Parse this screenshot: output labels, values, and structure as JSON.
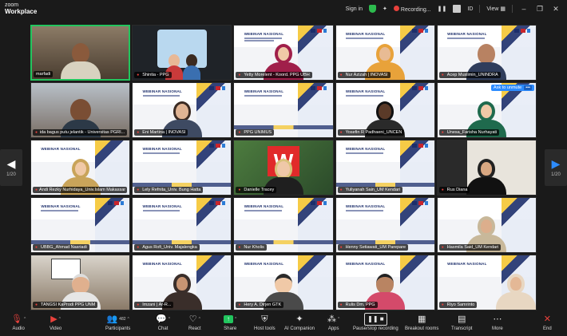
{
  "app": {
    "brand_line1": "zoom",
    "brand_line2": "Workplace"
  },
  "titlebar": {
    "sign_in": "Sign in",
    "recording": "Recording...",
    "id_label": "ID",
    "view": "View"
  },
  "nav": {
    "left_page": "1/20",
    "right_page": "1/20"
  },
  "tiles": [
    {
      "name": "marfadi",
      "active": true
    },
    {
      "name": "Shintia - PPG"
    },
    {
      "name": "Yetty Morelent - Koord. PPG UBH"
    },
    {
      "name": "Nur Azizah | INOVASI"
    },
    {
      "name": "Acep Muslimin_UNINDRA"
    },
    {
      "name": "ida bagus putu jelantik - Universitas PGRI..."
    },
    {
      "name": "Eni Martina | INOVASI"
    },
    {
      "name": "PPG UNIMUS"
    },
    {
      "name": "Yosefin R Padhaeni_UNCEN"
    },
    {
      "name": "Unesa_Farisha Nurhayati",
      "ask_unmute": "Ask to unmute"
    },
    {
      "name": "Andi Rezky Nurhidaya_Univ.Islam Makassar"
    },
    {
      "name": "Lely Refnita_Univ. Bung Hatta"
    },
    {
      "name": "Danielle Tracey"
    },
    {
      "name": "Yuliyanah Sain_UM Kendari"
    },
    {
      "name": "Rus Diana"
    },
    {
      "name": "UBBG_Ahmad Nasriadi"
    },
    {
      "name": "Agus Rofi_Univ. Majalengka"
    },
    {
      "name": "Nur Kholis"
    },
    {
      "name": "Henny Setiawati_UM Parepare"
    },
    {
      "name": "Hasmila Said_UM Kendari"
    },
    {
      "name": "TANGSI KaProdi PPG UNM"
    },
    {
      "name": "Imzani | Ar-R..."
    },
    {
      "name": "Hery A. Dirjen GTK"
    },
    {
      "name": "Rulis Dm. PPG"
    },
    {
      "name": "Riyo Samrinto"
    }
  ],
  "slide": {
    "title": "WEBINAR NASIONAL"
  },
  "toolbar": {
    "audio": "Audio",
    "video": "Video",
    "participants": "Participants",
    "participants_count": "482",
    "chat": "Chat",
    "react": "React",
    "share": "Share",
    "host_tools": "Host tools",
    "ai_companion": "AI Companion",
    "apps": "Apps",
    "pause_recording": "Pause/stop recording",
    "breakout": "Breakout rooms",
    "transcript": "Transcript",
    "more": "More",
    "end": "End"
  }
}
